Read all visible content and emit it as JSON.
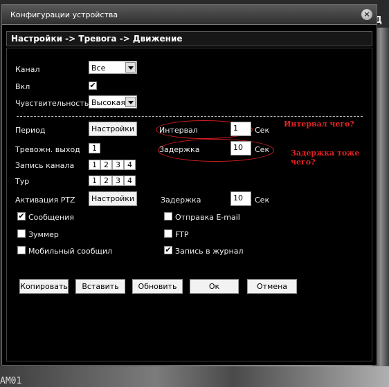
{
  "window": {
    "title": "Конфигурации устройства",
    "close_icon": "×"
  },
  "breadcrumb": "Настройки -> Тревога -> Движение",
  "background": {
    "edge_label": "Д",
    "camera_label": "AM01"
  },
  "form": {
    "channel": {
      "label": "Канал",
      "value": "Все"
    },
    "enabled": {
      "label": "Вкл",
      "checked": true
    },
    "sensitivity": {
      "label": "Чувствительность",
      "value": "Высокая"
    },
    "period": {
      "label": "Период",
      "button": "Настройки"
    },
    "interval": {
      "label": "Интервал",
      "value": "1",
      "unit": "Сек"
    },
    "alarm_output": {
      "label": "Тревожн. выход",
      "options": [
        "1"
      ]
    },
    "delay": {
      "label": "Задержка",
      "value": "10",
      "unit": "Сек"
    },
    "record_channel": {
      "label": "Запись канала",
      "options": [
        "1",
        "2",
        "3",
        "4"
      ]
    },
    "tour": {
      "label": "Тур",
      "options": [
        "1",
        "2",
        "3",
        "4"
      ]
    },
    "ptz": {
      "label": "Активация PTZ",
      "button": "Настройки",
      "delay_label": "Задержка",
      "delay_value": "10",
      "delay_unit": "Сек"
    },
    "checks": {
      "messages": {
        "label": "Сообщения",
        "checked": true
      },
      "email": {
        "label": "Отправка E-mail",
        "checked": false
      },
      "buzzer": {
        "label": "Зуммер",
        "checked": false
      },
      "ftp": {
        "label": "FTP",
        "checked": false
      },
      "mobile": {
        "label": "Мобильный сообщил",
        "checked": false
      },
      "log": {
        "label": "Запись в журнал",
        "checked": true
      }
    }
  },
  "buttons": {
    "copy": "Копировать",
    "paste": "Вставить",
    "refresh": "Обновить",
    "ok": "Ок",
    "cancel": "Отмена"
  },
  "annotations": {
    "interval_note": "Интервал чего?",
    "delay_note": "Задержка тоже чего?"
  },
  "colors": {
    "annotation": "#e02424"
  }
}
